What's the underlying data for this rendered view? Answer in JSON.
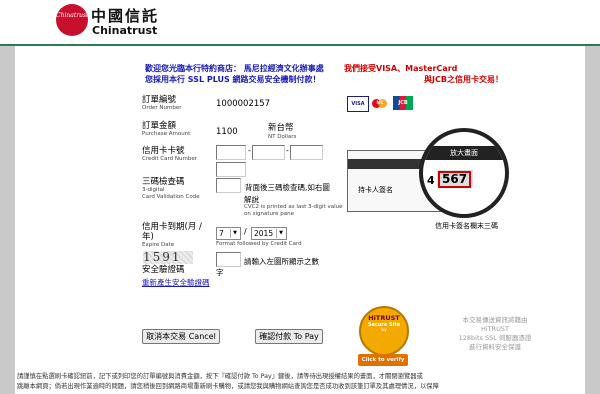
{
  "brand": {
    "logo_text": "Chinatrust",
    "name_cn": "中國信託",
    "name_en": "Chinatrust"
  },
  "notice": {
    "line1": "歡迎您光臨本行特約商店： 馬尼拉經濟文化辦事處",
    "line2": "您採用本行 SSL PLUS 網路交易安全機制付款！",
    "accept_line1": "我們接受VISA、MasterCard",
    "accept_line2": "與JCB之信用卡交易！"
  },
  "cards": {
    "visa": "VISA",
    "mastercard": "MC",
    "jcb": "JCB"
  },
  "form": {
    "order_label": "訂單編號",
    "order_sub": "Order Number",
    "order_value": "1000002157",
    "amount_label": "訂單金額",
    "amount_sub": "Purchase Amount",
    "amount_value": "1100",
    "currency": "新台幣",
    "currency_sub": "NT Dollars",
    "card_label": "信用卡卡號",
    "card_sub": "Credit Card Number",
    "card_dash": "-",
    "cvc_label": "三碼檢查碼",
    "cvc_sub1": "3-digital",
    "cvc_sub2": "Card Validation Code",
    "cvc_hint": "背面後三碼檢查碼,如右圖",
    "cvc_hint2": "解說",
    "cvc_en": "CVC2 is printed as last 3-digit value on signature pane",
    "expiry_label": "信用卡到期(月 / 年)",
    "expiry_sub": "Expire Date",
    "expiry_month": "7",
    "expiry_year": "2015",
    "expiry_slash": "/",
    "expiry_note": "Format followed by Credit Card",
    "captcha_image": "1591",
    "captcha_label": "安全驗證碼",
    "captcha_hint": "請輸入左圖所顯示之數",
    "captcha_hint2": "字",
    "captcha_refresh": "重新產生安全驗證碼"
  },
  "illustration": {
    "zoom_title": "放大畫面",
    "holder_label": "持卡人簽名",
    "digit_prefix": "4",
    "digits": "567",
    "caption": "信用卡簽名欄末三碼"
  },
  "buttons": {
    "cancel": "取消本交易 Cancel",
    "confirm": "確認付款 To Pay"
  },
  "seal": {
    "brand": "HiTRUST",
    "line": "Secure Site",
    "by": "by",
    "verify": "Click to verify"
  },
  "trust_note": {
    "line1": "本交易傳送資訊將藉由",
    "line2": "HiTRUST",
    "line3": "128bits SSL 伺服器憑證",
    "line4": "進行資料安全保護"
  },
  "footer": {
    "line1": "請謹慎在點選刷卡確認鈕前，記下或列印您的訂單編號與消費金額，按下『確認付款 To Pay』鍵後，請等待出現授權結果的畫面，才關閉瀏覽器或",
    "line2": "跳離本網頁；倘若出現作業逾時的問題，請您稍後回到網路商場重新刷卡購物，或請您我與購物網站查詢您是否成功收到該筆訂單及其處理情況，以保障"
  }
}
